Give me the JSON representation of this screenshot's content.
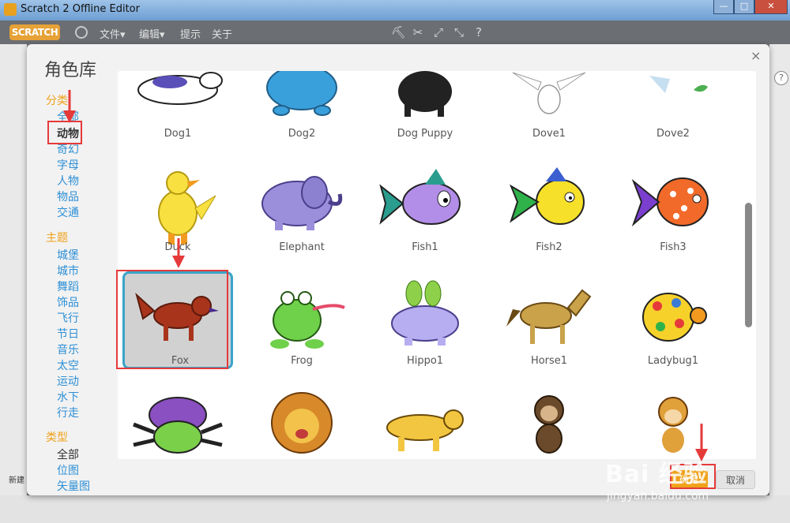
{
  "window": {
    "title": "Scratch 2 Offline Editor",
    "min": "—",
    "max": "□",
    "close": "✕"
  },
  "menubar": {
    "logo": "SCRATCH",
    "file": "文件▾",
    "edit": "编辑▾",
    "tips": "提示",
    "about": "关于"
  },
  "editor": {
    "help": "?",
    "new_label": "新建"
  },
  "dialog": {
    "title": "角色库",
    "close": "×",
    "categories": {
      "heading": "分类",
      "items": [
        "全部",
        "动物",
        "奇幻",
        "字母",
        "人物",
        "物品",
        "交通"
      ],
      "selected": "动物"
    },
    "themes": {
      "heading": "主题",
      "items": [
        "城堡",
        "城市",
        "舞蹈",
        "饰品",
        "飞行",
        "节日",
        "音乐",
        "太空",
        "运动",
        "水下",
        "行走"
      ]
    },
    "types": {
      "heading": "类型",
      "items": [
        "全部",
        "位图",
        "矢量图"
      ],
      "selected": "全部"
    },
    "sprites": {
      "row1": [
        "Dog1",
        "Dog2",
        "Dog Puppy",
        "Dove1",
        "Dove2"
      ],
      "row2": [
        "Duck",
        "Elephant",
        "Fish1",
        "Fish2",
        "Fish3"
      ],
      "row3": [
        "Fox",
        "Frog",
        "Hippo1",
        "Horse1",
        "Ladybug1"
      ],
      "selected": "Fox"
    },
    "ok": "确定",
    "cancel": "取消"
  },
  "watermark": {
    "line1": "Bai 经验",
    "line2": "jingyan.baidu.com"
  },
  "colors": {
    "accent": "#f0a21a",
    "link": "#2c8fd6",
    "select_border": "#3aa3c9",
    "annotation": "#e53a3a"
  }
}
